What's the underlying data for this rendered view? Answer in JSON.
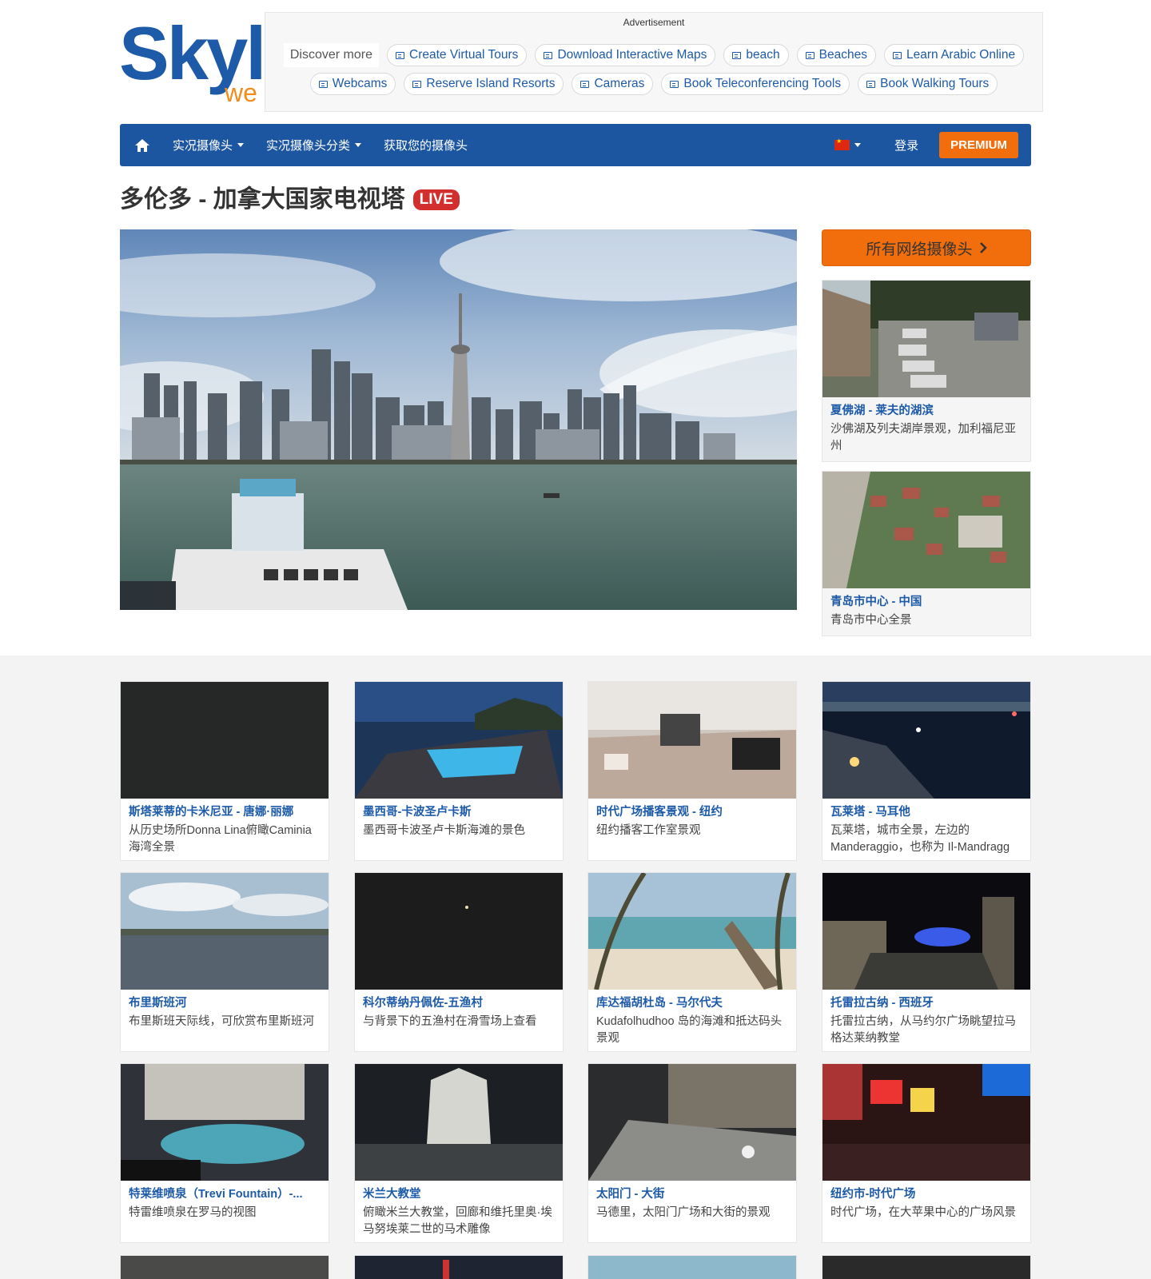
{
  "logo": {
    "main": "Skyli",
    "sub": "we"
  },
  "ad": {
    "label": "Advertisement",
    "discover": "Discover more",
    "row1": [
      "Create Virtual Tours",
      "Download Interactive Maps",
      "beach",
      "Beaches",
      "Learn Arabic Online"
    ],
    "row2": [
      "Webcams",
      "Reserve Island Resorts",
      "Cameras",
      "Book Teleconferencing Tools",
      "Book Walking Tours"
    ]
  },
  "nav": {
    "live_cams": "实况摄像头",
    "categories": "实况摄像头分类",
    "get_cam": "获取您的摄像头",
    "login": "登录",
    "premium": "PREMIUM"
  },
  "page": {
    "title": "多伦多 - 加拿大国家电视塔",
    "live": "LIVE"
  },
  "sidebar": {
    "all_button": "所有网络摄像头",
    "cards": [
      {
        "title": "夏佛湖 - 莱夫的湖滨",
        "desc": "沙佛湖及列夫湖岸景观，加利福尼亚州"
      },
      {
        "title": "青岛市中心 - 中国",
        "desc": "青岛市中心全景"
      }
    ]
  },
  "grid": [
    {
      "title": "斯塔莱蒂的卡米尼亚 - 唐娜·丽娜",
      "desc": "从历史场所Donna Lina俯瞰Caminia海湾全景"
    },
    {
      "title": "墨西哥-卡波圣卢卡斯",
      "desc": "墨西哥卡波圣卢卡斯海滩的景色"
    },
    {
      "title": "时代广场播客景观 - 纽约",
      "desc": "纽约播客工作室景观"
    },
    {
      "title": "瓦莱塔 - 马耳他",
      "desc": "瓦莱塔，城市全景，左边的Manderaggio，也称为 Il-Mandragg"
    },
    {
      "title": "布里斯班河",
      "desc": "布里斯班天际线，可欣赏布里斯班河"
    },
    {
      "title": "科尔蒂纳丹佩佐-五渔村",
      "desc": "与背景下的五渔村在滑雪场上查看"
    },
    {
      "title": "库达福胡杜岛 - 马尔代夫",
      "desc": "Kudafolhudhoo 岛的海滩和抵达码头景观"
    },
    {
      "title": "托雷拉古纳 - 西班牙",
      "desc": "托雷拉古纳，从马约尔广场眺望拉马格达莱纳教堂"
    },
    {
      "title": "特莱维喷泉（Trevi Fountain）-...",
      "desc": "特雷维喷泉在罗马的视图"
    },
    {
      "title": "米兰大教堂",
      "desc": "俯瞰米兰大教堂，回廊和维托里奥·埃马努埃莱二世的马术雕像"
    },
    {
      "title": "太阳门 - 大街",
      "desc": "马德里，太阳门广场和大街的景观"
    },
    {
      "title": "纽约市-时代广场",
      "desc": "时代广场，在大苹果中心的广场风景"
    }
  ]
}
